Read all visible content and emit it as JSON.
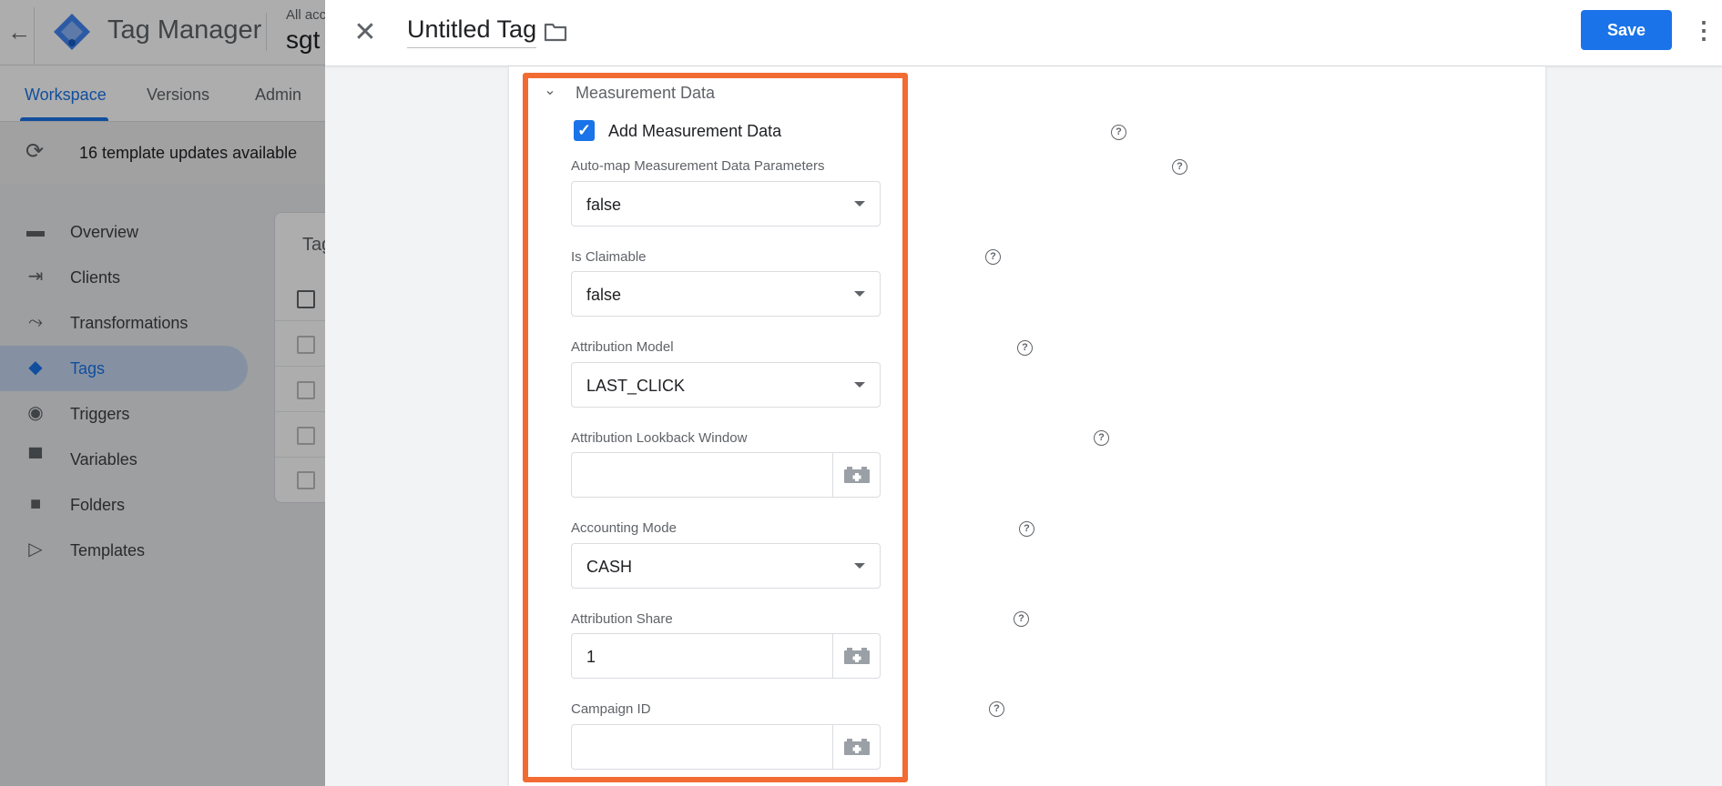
{
  "app": {
    "title": "Tag Manager",
    "account_label": "All acc",
    "container_name": "sgt",
    "nav_tabs": [
      {
        "label": "Workspace",
        "active": true
      },
      {
        "label": "Versions",
        "active": false
      },
      {
        "label": "Admin",
        "active": false
      }
    ],
    "updates_text": "16 template updates available",
    "sidebar": [
      {
        "label": "Overview",
        "icon": "overview-icon",
        "active": false
      },
      {
        "label": "Clients",
        "icon": "clients-icon",
        "active": false
      },
      {
        "label": "Transformations",
        "icon": "transformations-icon",
        "active": false
      },
      {
        "label": "Tags",
        "icon": "tag-icon",
        "active": true
      },
      {
        "label": "Triggers",
        "icon": "triggers-icon",
        "active": false
      },
      {
        "label": "Variables",
        "icon": "variables-icon",
        "active": false
      },
      {
        "label": "Folders",
        "icon": "folder-icon",
        "active": false
      },
      {
        "label": "Templates",
        "icon": "templates-icon",
        "active": false
      }
    ],
    "card_title": "Tag"
  },
  "sheet": {
    "tag_name": "Untitled Tag",
    "save_label": "Save",
    "close_icon": "close-icon",
    "more_icon": "more-vert-icon",
    "section_title": "Measurement Data",
    "add_measurement": {
      "label": "Add Measurement Data",
      "checked": true
    },
    "fields": {
      "automap": {
        "label": "Auto-map Measurement Data Parameters",
        "value": "false",
        "type": "select"
      },
      "claimable": {
        "label": "Is Claimable",
        "value": "false",
        "type": "select"
      },
      "attribution_model": {
        "label": "Attribution Model",
        "value": "LAST_CLICK",
        "type": "select"
      },
      "lookback_window": {
        "label": "Attribution Lookback Window",
        "value": "",
        "type": "text"
      },
      "accounting_mode": {
        "label": "Accounting Mode",
        "value": "CASH",
        "type": "select"
      },
      "attribution_share": {
        "label": "Attribution Share",
        "value": "1",
        "type": "text"
      },
      "campaign_id": {
        "label": "Campaign ID",
        "value": "",
        "type": "text"
      }
    },
    "highlight_color": "#f26b33",
    "accent_color": "#1a73e8",
    "help_glyph": "?",
    "check_glyph": "✓"
  }
}
